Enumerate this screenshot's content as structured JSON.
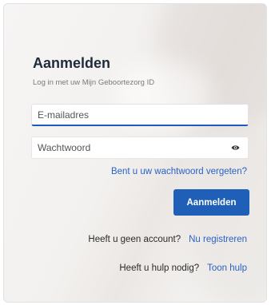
{
  "login": {
    "title": "Aanmelden",
    "subtitle": "Log in met uw Mijn Geboortezorg ID",
    "email_placeholder": "E-mailadres",
    "password_placeholder": "Wachtwoord",
    "password_toggle_icon": "eye-icon",
    "forgot_password": "Bent u uw wachtwoord vergeten?",
    "submit_label": "Aanmelden",
    "no_account_text": "Heeft u geen account?",
    "register_link": "Nu registreren",
    "help_text": "Heeft u hulp nodig?",
    "help_link": "Toon hulp"
  },
  "colors": {
    "accent": "#1f5fb8",
    "link": "#2a63c4",
    "title": "#1f2a3a"
  }
}
